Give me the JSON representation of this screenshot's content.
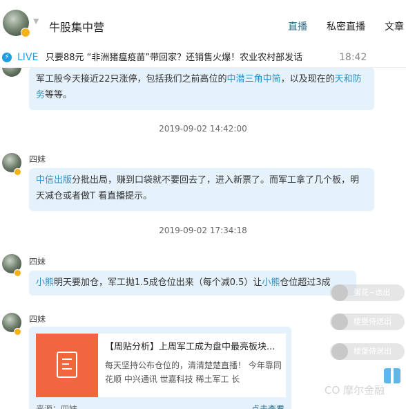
{
  "header": {
    "title": "牛股集中营",
    "tabs": [
      {
        "label": "直播",
        "active": true
      },
      {
        "label": "私密直播",
        "active": false
      },
      {
        "label": "文章",
        "active": false
      }
    ]
  },
  "ticker": {
    "live_label": "LIVE",
    "text": "只要88元 “非洲猪瘟疫苗”带回家？还销售火爆！农业农村部发话",
    "time": "18:42"
  },
  "messages": [
    {
      "segments": [
        "军工股今天接近22只涨停，包括我们之前高位的",
        "中潜",
        "三角",
        "中简",
        "，以及现在的",
        "天和防务",
        "等等。"
      ]
    },
    {
      "timestamp": "2019-09-02 14:42:00",
      "sender": "四妹",
      "segments": [
        "中信出版",
        "分批出局，赚到口袋就不要回去了，进入新票了。而军工拿了几个板，明天减仓或者做T 看直播提示。"
      ]
    },
    {
      "timestamp": "2019-09-02 17:34:18",
      "sender": "四妹",
      "segments": [
        "小熊",
        "明天要加仓，军工抛1.5成仓位出来（每个减0.5）让",
        "小熊",
        "仓位超过3成"
      ]
    },
    {
      "sender": "四妹",
      "card": {
        "title": "【周贴分析】上周军工成为盘中最亮板块...",
        "desc": "每天坚持公布仓位的，清清楚楚直播！ 今年靠同花顺 中兴通讯 世嘉科技 稀土军工 长",
        "source": "来源：四妹",
        "action": "点击查看"
      }
    }
  ],
  "gifts": [
    "蛋花~送出",
    "楼堡侍送出",
    "楼堡侍送出"
  ],
  "watermark": "摩尔金融",
  "colors": {
    "accent": "#2a6c86",
    "highlight": "#2a8fc3",
    "bubble": "#e5f2fb",
    "live": "#1e9ede",
    "card_thumb": "#f2663f"
  }
}
